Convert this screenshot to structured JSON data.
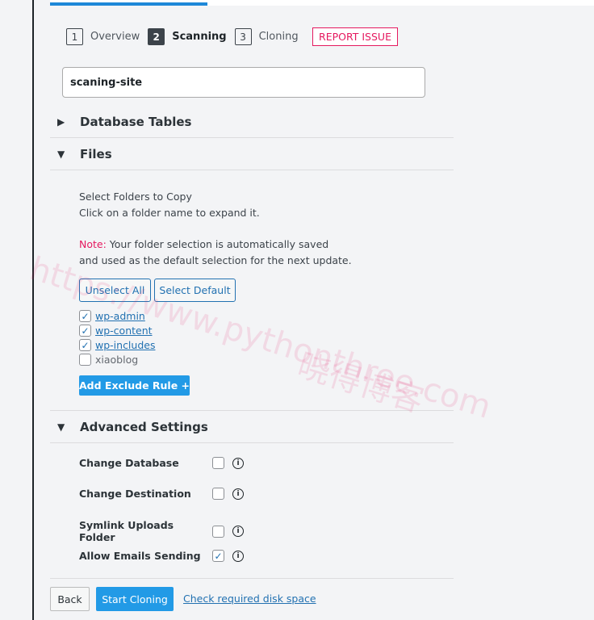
{
  "progress_percent": 29,
  "steps": [
    {
      "num": "1",
      "label": "Overview"
    },
    {
      "num": "2",
      "label": "Scanning"
    },
    {
      "num": "3",
      "label": "Cloning"
    }
  ],
  "report_issue": "REPORT ISSUE",
  "clone_name": "scaning-site",
  "sections": {
    "database": "Database Tables",
    "files": "Files",
    "advanced": "Advanced Settings"
  },
  "files": {
    "heading": "Select Folders to Copy",
    "hint": "Click on a folder name to expand it.",
    "note_label": "Note:",
    "note_line1": " Your folder selection is automatically saved",
    "note_line2": "and used as the default selection for the next update.",
    "unselect_all": "Unselect All",
    "select_default": "Select Default",
    "folders": [
      {
        "name": "wp-admin",
        "checked": true
      },
      {
        "name": "wp-content",
        "checked": true
      },
      {
        "name": "wp-includes",
        "checked": true
      },
      {
        "name": "xiaoblog",
        "checked": false
      }
    ],
    "add_exclude": "Add Exclude Rule +"
  },
  "advanced": [
    {
      "label": "Change Database",
      "checked": false
    },
    {
      "label": "Change Destination",
      "checked": false
    },
    {
      "label": "Symlink Uploads Folder",
      "checked": false
    },
    {
      "label": "Allow Emails Sending",
      "checked": true
    }
  ],
  "footer": {
    "back": "Back",
    "start": "Start Cloning",
    "disk": "Check required disk space"
  },
  "watermark": {
    "url": "https://www.pythonthree.com",
    "cn": "晓得博客"
  }
}
